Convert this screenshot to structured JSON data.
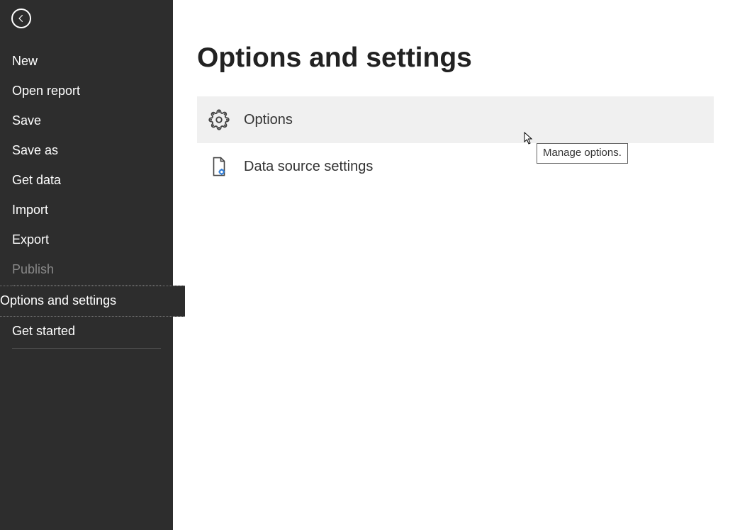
{
  "sidebar": {
    "items": [
      {
        "label": "New"
      },
      {
        "label": "Open report"
      },
      {
        "label": "Save"
      },
      {
        "label": "Save as"
      },
      {
        "label": "Get data"
      },
      {
        "label": "Import"
      },
      {
        "label": "Export"
      },
      {
        "label": "Publish"
      },
      {
        "label": "Options and settings"
      },
      {
        "label": "Get started"
      }
    ]
  },
  "main": {
    "title": "Options and settings",
    "items": [
      {
        "label": "Options"
      },
      {
        "label": "Data source settings"
      }
    ]
  },
  "tooltip": {
    "text": "Manage options."
  }
}
